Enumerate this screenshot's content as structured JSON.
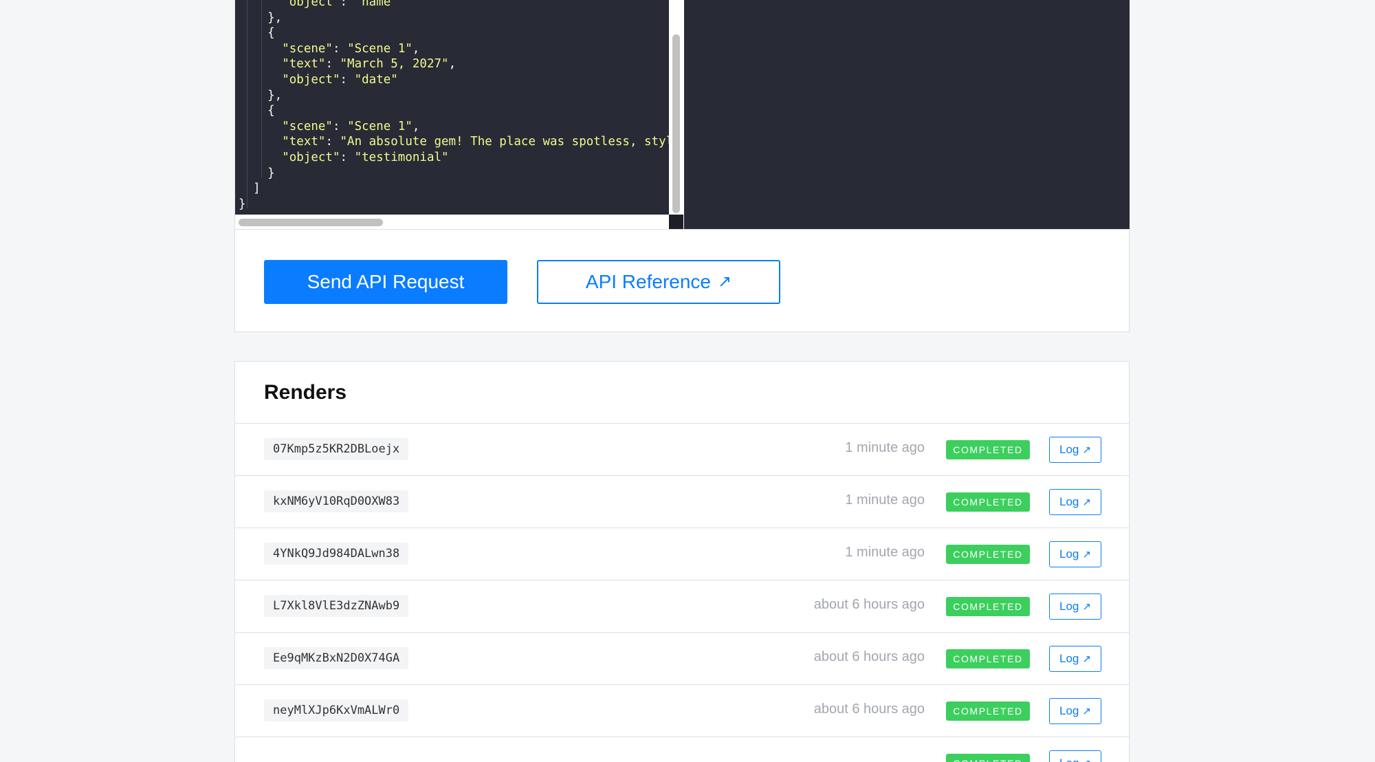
{
  "editor": {
    "code_lines": [
      [
        {
          "t": "      ",
          "c": "punc"
        },
        {
          "t": "\"object\"",
          "c": "str"
        },
        {
          "t": ": ",
          "c": "punc"
        },
        {
          "t": "\"name\"",
          "c": "str"
        }
      ],
      [
        {
          "t": "    },",
          "c": "punc"
        }
      ],
      [
        {
          "t": "    {",
          "c": "punc"
        }
      ],
      [
        {
          "t": "      ",
          "c": "punc"
        },
        {
          "t": "\"scene\"",
          "c": "str"
        },
        {
          "t": ": ",
          "c": "punc"
        },
        {
          "t": "\"Scene 1\"",
          "c": "str"
        },
        {
          "t": ",",
          "c": "punc"
        }
      ],
      [
        {
          "t": "      ",
          "c": "punc"
        },
        {
          "t": "\"text\"",
          "c": "str"
        },
        {
          "t": ": ",
          "c": "punc"
        },
        {
          "t": "\"March 5, 2027\"",
          "c": "str"
        },
        {
          "t": ",",
          "c": "punc"
        }
      ],
      [
        {
          "t": "      ",
          "c": "punc"
        },
        {
          "t": "\"object\"",
          "c": "str"
        },
        {
          "t": ": ",
          "c": "punc"
        },
        {
          "t": "\"date\"",
          "c": "str"
        }
      ],
      [
        {
          "t": "    },",
          "c": "punc"
        }
      ],
      [
        {
          "t": "    {",
          "c": "punc"
        }
      ],
      [
        {
          "t": "      ",
          "c": "punc"
        },
        {
          "t": "\"scene\"",
          "c": "str"
        },
        {
          "t": ": ",
          "c": "punc"
        },
        {
          "t": "\"Scene 1\"",
          "c": "str"
        },
        {
          "t": ",",
          "c": "punc"
        }
      ],
      [
        {
          "t": "      ",
          "c": "punc"
        },
        {
          "t": "\"text\"",
          "c": "str"
        },
        {
          "t": ": ",
          "c": "punc"
        },
        {
          "t": "\"An absolute gem! The place was spotless, styli",
          "c": "str"
        }
      ],
      [
        {
          "t": "      ",
          "c": "punc"
        },
        {
          "t": "\"object\"",
          "c": "str"
        },
        {
          "t": ": ",
          "c": "punc"
        },
        {
          "t": "\"testimonial\"",
          "c": "str"
        }
      ],
      [
        {
          "t": "    }",
          "c": "punc"
        }
      ],
      [
        {
          "t": "  ]",
          "c": "punc"
        }
      ],
      [
        {
          "t": "}",
          "c": "punc"
        }
      ]
    ]
  },
  "actions": {
    "send_label": "Send API Request",
    "reference_label": "API Reference",
    "arrow_glyph": "↗"
  },
  "renders": {
    "title": "Renders",
    "log_label": "Log",
    "arrow_glyph": "↗",
    "rows": [
      {
        "id": "07Kmp5z5KR2DBLoejx",
        "time": "1 minute ago",
        "status": "COMPLETED"
      },
      {
        "id": "kxNM6yV10RqD0OXW83",
        "time": "1 minute ago",
        "status": "COMPLETED"
      },
      {
        "id": "4YNkQ9Jd984DALwn38",
        "time": "1 minute ago",
        "status": "COMPLETED"
      },
      {
        "id": "L7Xkl8VlE3dzZNAwb9",
        "time": "about 6 hours ago",
        "status": "COMPLETED"
      },
      {
        "id": "Ee9qMKzBxN2D0X74GA",
        "time": "about 6 hours ago",
        "status": "COMPLETED"
      },
      {
        "id": "neyMlXJp6KxVmALWr0",
        "time": "about 6 hours ago",
        "status": "COMPLETED"
      },
      {
        "id": "",
        "time": "",
        "status": "COMPLETED"
      }
    ]
  },
  "colors": {
    "accent": "#0a7cff",
    "status_completed": "#3ccf5e",
    "editor_bg": "#282a36",
    "string": "#f1fa8c"
  }
}
